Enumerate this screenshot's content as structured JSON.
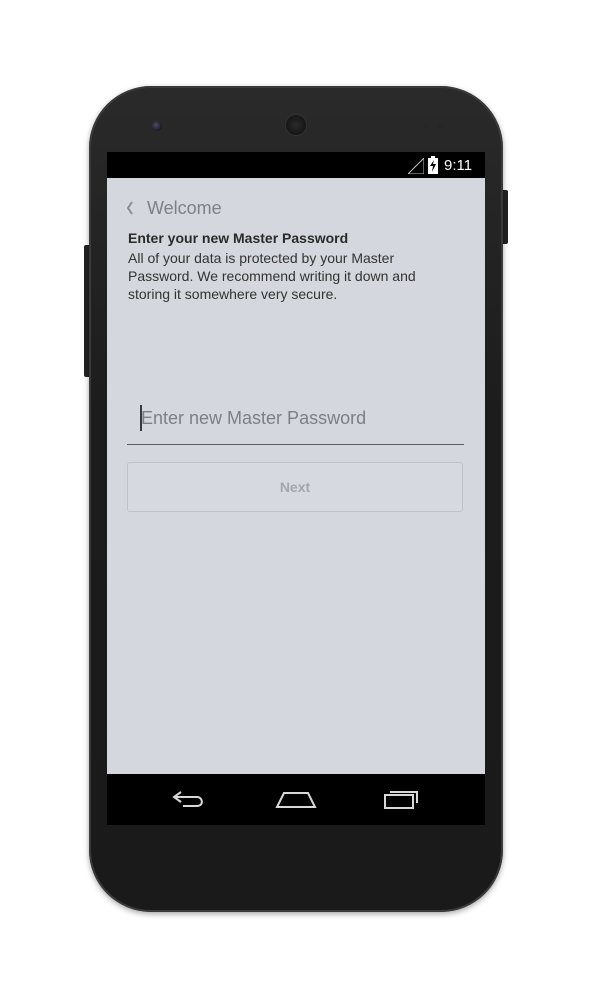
{
  "status_bar": {
    "time": "9:11",
    "signal_icon": "signal-icon",
    "battery_icon": "battery-charging-icon"
  },
  "header": {
    "back_icon": "chevron-left-icon",
    "title": "Welcome"
  },
  "content": {
    "heading": "Enter your new Master Password",
    "description": "All of your data is protected by your Master Password. We recommend writing it down and storing it somewhere very secure."
  },
  "password_field": {
    "value": "",
    "placeholder": "Enter new Master Password"
  },
  "next_button": {
    "label": "Next"
  },
  "navigation_bar": {
    "back_icon": "back-icon",
    "home_icon": "home-icon",
    "recents_icon": "recents-icon"
  },
  "colors": {
    "app_background": "#d4d7dd",
    "heading_text": "#2a2a2a",
    "muted_text": "#7d8088",
    "disabled_button_text": "#a3a6ac"
  }
}
